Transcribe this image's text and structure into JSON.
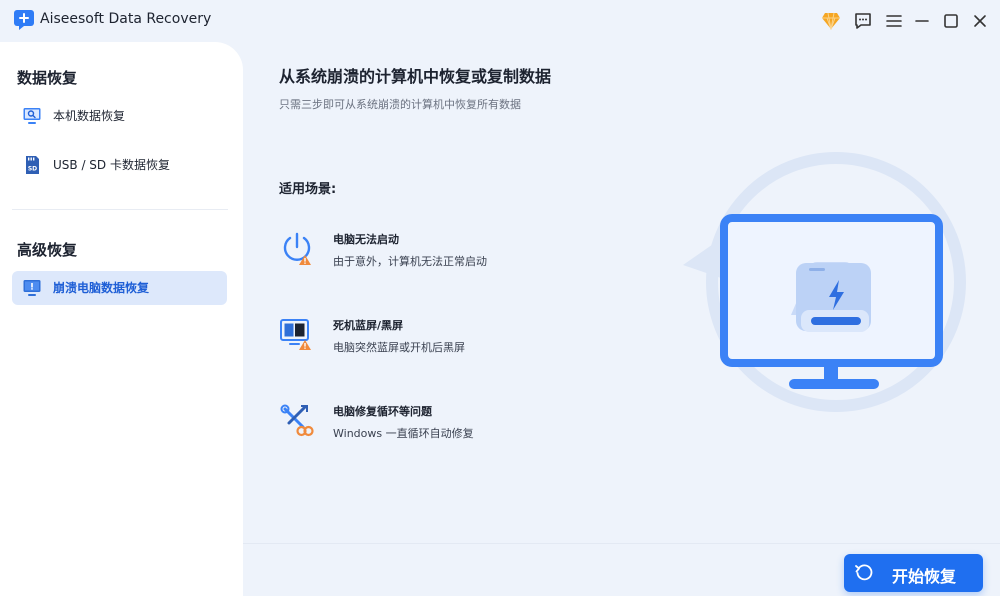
{
  "app": {
    "title": "Aiseesoft Data Recovery"
  },
  "sidebar": {
    "section1": "数据恢复",
    "section2": "高级恢复",
    "items": [
      {
        "label": "本机数据恢复",
        "icon": "pc-search-icon"
      },
      {
        "label": "USB / SD 卡数据恢复",
        "icon": "sd-card-icon"
      },
      {
        "label": "崩溃电脑数据恢复",
        "icon": "crashed-pc-icon"
      }
    ]
  },
  "main": {
    "title": "从系统崩溃的计算机中恢复或复制数据",
    "subtitle": "只需三步即可从系统崩溃的计算机中恢复所有数据",
    "scenarios_label": "适用场景:",
    "scenarios": [
      {
        "title": "电脑无法启动",
        "desc": "由于意外，计算机无法正常启动",
        "icon": "power-warning-icon"
      },
      {
        "title": "死机蓝屏/黑屏",
        "desc": "电脑突然蓝屏或开机后黑屏",
        "icon": "blue-screen-icon"
      },
      {
        "title": "电脑修复循环等问题",
        "desc": "Windows 一直循环自动修复",
        "icon": "repair-loop-icon"
      }
    ],
    "start_button": "开始恢复"
  },
  "colors": {
    "accent": "#1f6ff0",
    "active_bg": "#dde8fb",
    "warning": "#f08a3c",
    "premium": "#f5a623"
  }
}
